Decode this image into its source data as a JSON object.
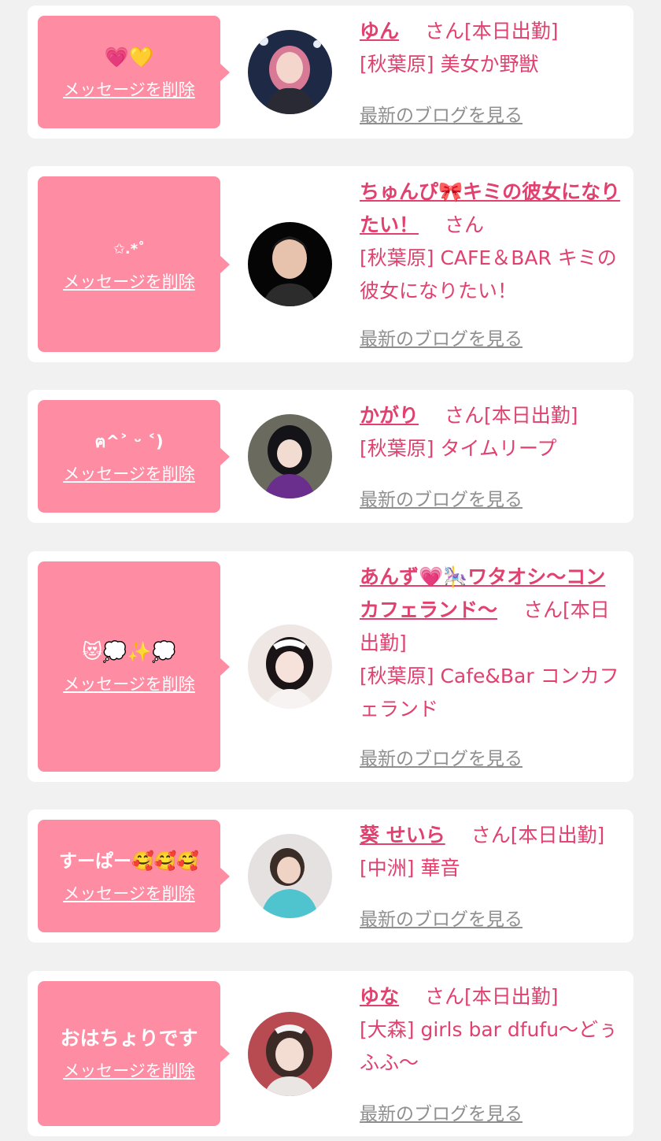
{
  "ui": {
    "delete_label": "メッセージを削除",
    "blog_label": "最新のブログを見る",
    "san_suffix": "さん"
  },
  "colors": {
    "page_bg": "#f1f1f1",
    "card_bg": "#ffffff",
    "bubble_bg": "#fe8da4",
    "accent": "#e0416f",
    "link_gray": "#8f8f8f"
  },
  "messages": [
    {
      "message": "💗💛",
      "name": "ゆん",
      "status": "[本日出勤]",
      "shop": "[秋葉原] 美女か野獣",
      "avatar_icon": "profile-photo"
    },
    {
      "message": "✩.*˚",
      "name": "ちゅんぴ🎀キミの彼女になりたい！",
      "status": "",
      "shop": "[秋葉原] CAFE＆BAR キミの彼女になりたい！",
      "avatar_icon": "profile-photo"
    },
    {
      "message": "ฅ^˃ ᵕ ˂)",
      "name": "かがり",
      "status": "[本日出勤]",
      "shop": "[秋葉原] タイムリープ",
      "avatar_icon": "profile-photo"
    },
    {
      "message": "😻💭✨💭",
      "name": "あんず💗🎠ワタオシ〜コンカフェランド〜",
      "status": "[本日出勤]",
      "shop": "[秋葉原] Cafe&Bar コンカフェランド",
      "avatar_icon": "profile-photo"
    },
    {
      "message": "すーぱー🥰🥰🥰",
      "name": "葵 せいら",
      "status": "[本日出勤]",
      "shop": "[中洲] 華音",
      "avatar_icon": "profile-photo"
    },
    {
      "message": "おはちょりです",
      "name": "ゆな",
      "status": "[本日出勤]",
      "shop": "[大森] girls bar dfufu〜どぅふふ〜",
      "avatar_icon": "profile-photo"
    }
  ]
}
